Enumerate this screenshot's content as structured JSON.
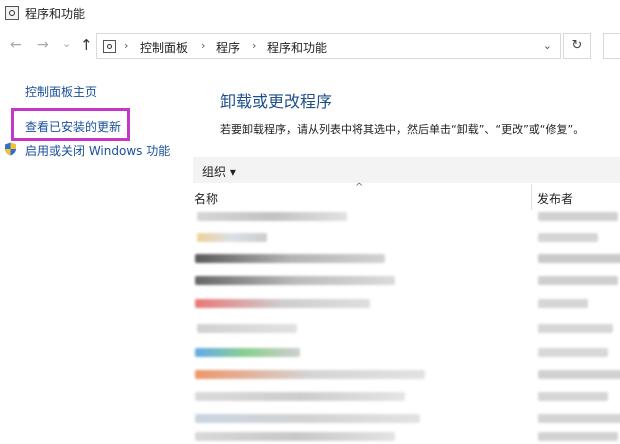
{
  "window": {
    "title": "程序和功能"
  },
  "nav": {
    "back": "←",
    "forward": "→",
    "recent": "⌄",
    "up": "↑"
  },
  "address": {
    "crumbs": [
      "控制面板",
      "程序",
      "程序和功能"
    ],
    "separator": "›",
    "dropdown": "⌄",
    "refresh": "↻"
  },
  "sidebar": {
    "items": [
      {
        "label": "控制面板主页"
      },
      {
        "label": "查看已安装的更新"
      },
      {
        "label": "启用或关闭 Windows 功能"
      }
    ]
  },
  "main": {
    "title": "卸载或更改程序",
    "description": "若要卸载程序，请从列表中将其选中，然后单击“卸载”、“更改”或“修复”。"
  },
  "toolbar": {
    "organize": "组织 ▾"
  },
  "table": {
    "sort_indicator": "^",
    "columns": [
      "名称",
      "发布者"
    ]
  },
  "colors": {
    "highlight": "#c537c9",
    "link": "#1a4f9c",
    "title": "#1e4f8c"
  }
}
